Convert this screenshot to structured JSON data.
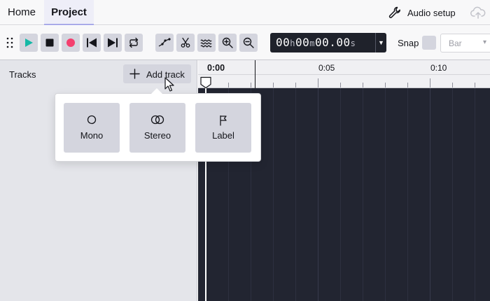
{
  "menubar": {
    "tabs": [
      {
        "label": "Home",
        "active": false
      },
      {
        "label": "Project",
        "active": true
      }
    ],
    "audio_setup_label": "Audio setup",
    "icons": {
      "audio_setup": "wrench-icon",
      "cloud": "cloud-upload-icon"
    }
  },
  "toolbar": {
    "transport_icons": [
      "play-icon",
      "stop-icon",
      "record-icon",
      "skip-to-start-icon",
      "skip-to-end-icon",
      "loop-icon"
    ],
    "tool_icons": [
      "envelope-tool-icon",
      "cut-icon",
      "waveform-tool-icon",
      "zoom-in-icon",
      "zoom-out-icon"
    ],
    "timecode": {
      "hours": "00",
      "hours_unit": "h",
      "minutes": "00",
      "minutes_unit": "m",
      "seconds": "00.00",
      "seconds_unit": "s"
    },
    "snap_label": "Snap",
    "snap_checked": false,
    "snap_unit": "Bar"
  },
  "tracks_panel": {
    "title": "Tracks",
    "add_track_label": "Add track"
  },
  "timeline": {
    "ruler_labels": [
      "0:00",
      "0:05",
      "0:10"
    ]
  },
  "add_track_menu": {
    "options": [
      {
        "label": "Mono",
        "icon": "circle-icon"
      },
      {
        "label": "Stereo",
        "icon": "double-circle-icon"
      },
      {
        "label": "Label",
        "icon": "flag-icon"
      }
    ]
  },
  "colors": {
    "accent": "#a9aae8",
    "play": "#14b8a6",
    "record": "#f43f6e",
    "canvas": "#222531",
    "button": "#d4d5de",
    "panel": "#e4e5ea"
  }
}
